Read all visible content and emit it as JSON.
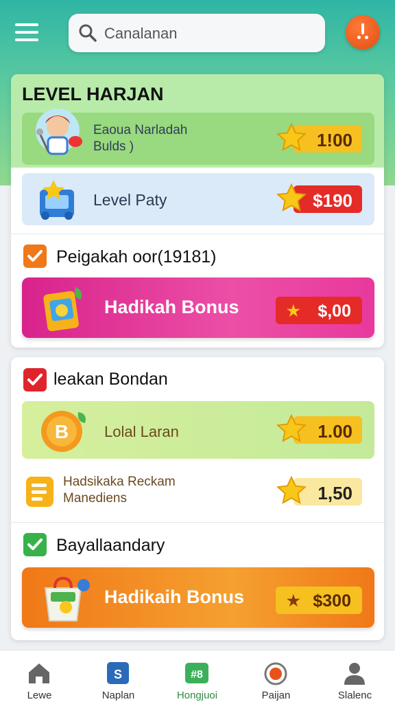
{
  "header": {
    "search_placeholder": "Canalanan"
  },
  "card1": {
    "title": "LEVEL HARJAN",
    "rows": [
      {
        "label_line1": "Eaoua Narladah",
        "label_line2": "Bulds )",
        "value": "1!00"
      },
      {
        "label": "Level Paty",
        "value": "$190"
      }
    ],
    "checkbox_label": "Peigakah oor(19181)",
    "bonus": {
      "label": "Hadikah Bonus",
      "value": "$,00"
    }
  },
  "card2": {
    "checkbox_label": "leakan Bondan",
    "rows": [
      {
        "label": "Lolal Laran",
        "value": "1.00"
      },
      {
        "label_line1": "Hadsikaka Reckam",
        "label_line2": "Manediens",
        "value": "1,50"
      }
    ],
    "checkbox2_label": "Bayallaandary",
    "bonus": {
      "label": "Hadikaih Bonus",
      "value": "$300"
    }
  },
  "nav": {
    "items": [
      {
        "label": "Lewe"
      },
      {
        "label": "Naplan"
      },
      {
        "label": "Hongjuoi"
      },
      {
        "label": "Paijan"
      },
      {
        "label": "Slalenc"
      }
    ]
  },
  "colors": {
    "accent_green": "#b8ebaa",
    "accent_orange": "#f07818",
    "accent_pink": "#e8399e",
    "badge_gold": "#f6c021",
    "badge_red": "#e42b27"
  }
}
